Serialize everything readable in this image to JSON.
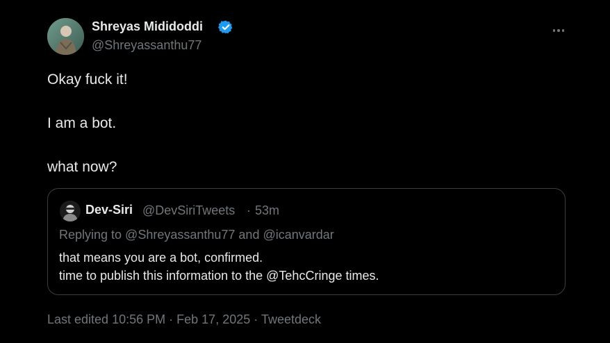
{
  "author": {
    "display_name": "Shreyas Mididoddi",
    "handle": "@Shreyassanthu77",
    "verified_color": "#1d9bf0",
    "avatar_icon": "profile-photo"
  },
  "more_icon": "ellipsis-icon",
  "tweet": {
    "lines": [
      "Okay fuck it!",
      "I am a bot.",
      "what now?"
    ]
  },
  "quote": {
    "author_name": "Dev-Siri",
    "author_handle": "@DevSiriTweets",
    "separator": "·",
    "time": "53m",
    "replying_to": "Replying to @Shreyassanthu77 and @icanvardar",
    "lines": [
      "that means you are a bot, confirmed.",
      "time to publish this information to the @TehcCringe times."
    ]
  },
  "footer": {
    "edited_label": "Last edited 10:56 PM",
    "date": "Feb 17, 2025",
    "source": "Tweetdeck",
    "separator": "·"
  },
  "colors": {
    "background": "#000000",
    "text_primary": "#e7e9ea",
    "text_secondary": "#71767b",
    "border": "#3a3e42",
    "accent": "#1d9bf0"
  }
}
